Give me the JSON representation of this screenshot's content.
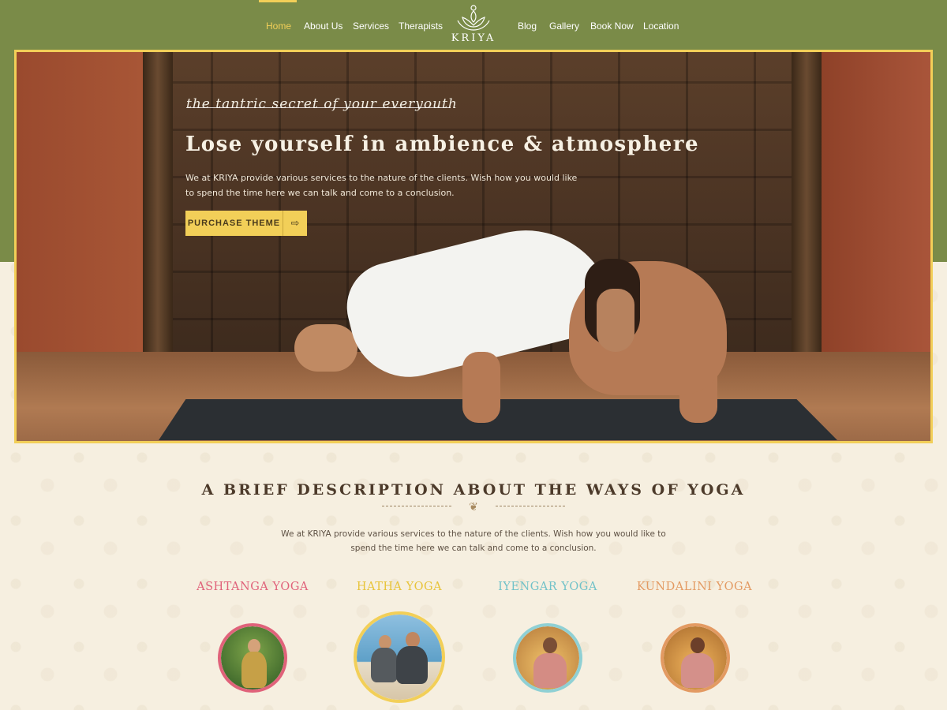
{
  "nav": {
    "left": [
      {
        "label": "Home",
        "active": true
      },
      {
        "label": "About Us"
      },
      {
        "label": "Services"
      },
      {
        "label": "Therapists"
      }
    ],
    "right": [
      {
        "label": "Blog"
      },
      {
        "label": "Gallery"
      },
      {
        "label": "Book Now"
      },
      {
        "label": "Location"
      }
    ],
    "logo_text": "KRIYA",
    "logo_icon": "lotus-meditation-icon"
  },
  "hero": {
    "tagline": "the tantric secret of your everyouth",
    "title": "Lose yourself in ambience & atmosphere",
    "text": "We at KRIYA provide various services to the nature of the clients. Wish how you would like to spend the time here we can talk and come to a conclusion.",
    "button_label": "PURCHASE THEME",
    "button_icon": "arrow-right-icon"
  },
  "section": {
    "title": "A BRIEF DESCRIPTION ABOUT THE WAYS OF YOGA",
    "text": "We at KRIYA provide various services to the nature of the clients. Wish how you would like to spend the time here we can talk and come to a conclusion."
  },
  "yoga_types": [
    {
      "title": "ASHTANGA YOGA",
      "color": "#e0627a"
    },
    {
      "title": "HATHA YOGA",
      "color": "#e8c43a"
    },
    {
      "title": "IYENGAR YOGA",
      "color": "#72c2c8"
    },
    {
      "title": "KUNDALINI YOGA",
      "color": "#e39a62"
    }
  ],
  "colors": {
    "header_green": "#7a8b48",
    "accent_yellow": "#f2cf58",
    "background_cream": "#f6efe0"
  }
}
